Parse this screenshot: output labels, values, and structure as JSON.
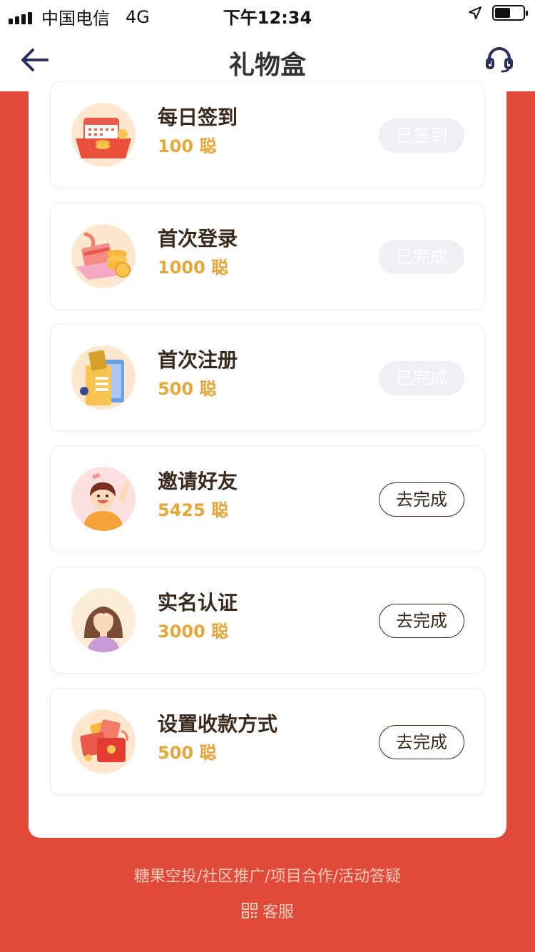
{
  "status_bar": {
    "carrier": "中国电信",
    "network": "4G",
    "time": "下午12:34",
    "battery_level": 0.55
  },
  "nav": {
    "title": "礼物盒",
    "back_icon": "arrow-left-icon",
    "service_icon": "headset-icon"
  },
  "tasks": [
    {
      "title": "每日签到",
      "reward": "100 聪",
      "button": "已签到",
      "state": "done",
      "icon": "calendar-coins-icon"
    },
    {
      "title": "首次登录",
      "reward": "1000 聪",
      "button": "已完成",
      "state": "done",
      "icon": "card-coins-icon"
    },
    {
      "title": "首次注册",
      "reward": "500 聪",
      "button": "已完成",
      "state": "done",
      "icon": "register-docs-icon"
    },
    {
      "title": "邀请好友",
      "reward": "5425 聪",
      "button": "去完成",
      "state": "todo",
      "icon": "happy-friend-icon"
    },
    {
      "title": "实名认证",
      "reward": "3000 聪",
      "button": "去完成",
      "state": "todo",
      "icon": "avatar-woman-icon"
    },
    {
      "title": "设置收款方式",
      "reward": "500 聪",
      "button": "去完成",
      "state": "todo",
      "icon": "red-envelope-icon"
    }
  ],
  "footer": {
    "links": "糖果空投/社区推广/项目合作/活动答疑",
    "service_label": "客服",
    "service_icon": "qrcode-icon"
  },
  "colors": {
    "background": "#e04a3b",
    "reward": "#e3a73b",
    "text_dark": "#3a2a1d",
    "done_button": "#eef0f5"
  }
}
